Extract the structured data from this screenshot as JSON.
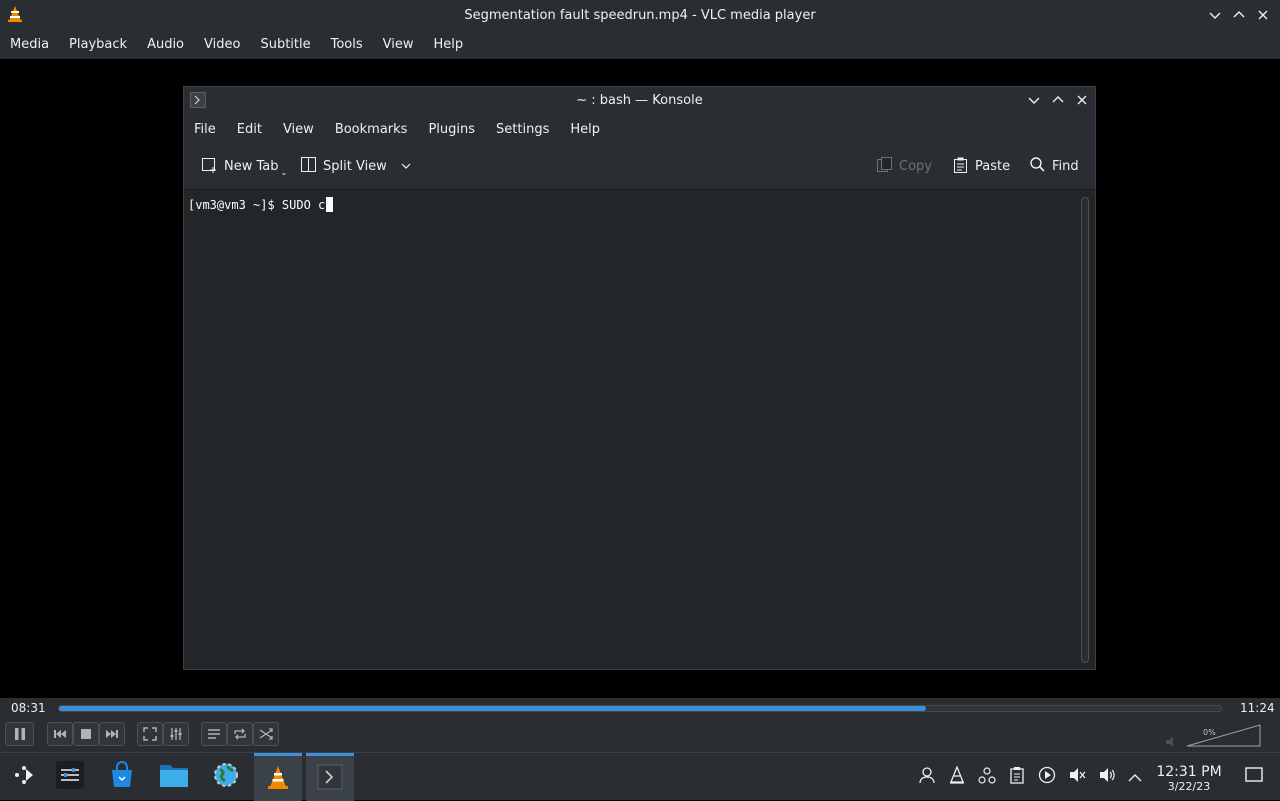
{
  "vlc": {
    "window_title": "Segmentation fault speedrun.mp4 - VLC media player",
    "menu": [
      "Media",
      "Playback",
      "Audio",
      "Video",
      "Subtitle",
      "Tools",
      "View",
      "Help"
    ],
    "time_elapsed": "08:31",
    "time_total": "11:24",
    "progress_fraction": 0.746,
    "volume_label": "0%",
    "accent_color": "#3d8fd9"
  },
  "konsole": {
    "window_title": "~ : bash — Konsole",
    "menu": [
      "File",
      "Edit",
      "View",
      "Bookmarks",
      "Plugins",
      "Settings",
      "Help"
    ],
    "toolbar": {
      "new_tab": "New Tab",
      "split_view": "Split View",
      "copy": "Copy",
      "paste": "Paste",
      "find": "Find"
    },
    "prompt": "[vm3@vm3 ~]$ ",
    "command": "SUDO c"
  },
  "taskbar": {
    "clock_time": "12:31 PM",
    "clock_date": "3/22/23",
    "launchers": [
      "application-launcher-icon",
      "system-settings-icon",
      "discover-store-icon",
      "file-manager-icon",
      "browser-icon",
      "vlc-icon",
      "konsole-icon"
    ],
    "tray_icons": [
      "user-icon",
      "vlc-tray-icon",
      "network-icon",
      "clipboard-icon",
      "media-player-icon",
      "muted-speaker-icon",
      "volume-icon",
      "expand-tray-icon"
    ]
  }
}
